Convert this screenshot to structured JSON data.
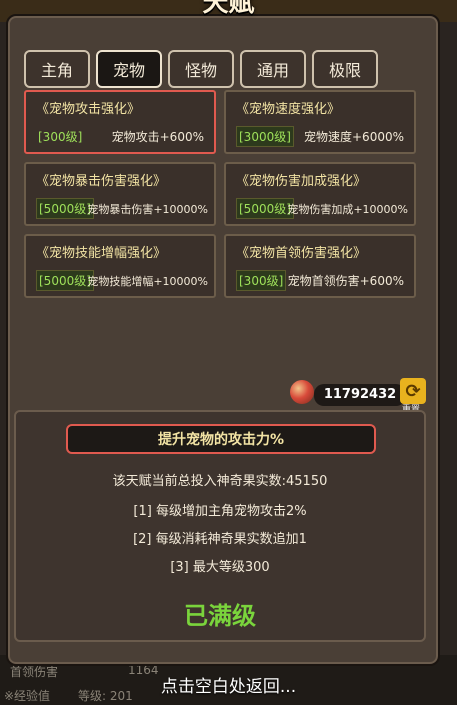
{
  "title": "天赋",
  "tabs": [
    "主角",
    "宠物",
    "怪物",
    "通用",
    "极限"
  ],
  "active_tab": "宠物",
  "cards": [
    {
      "name": "《宠物攻击强化》",
      "level": "[300级]",
      "effect": "宠物攻击+600%"
    },
    {
      "name": "《宠物速度强化》",
      "level": "[3000级]",
      "effect": "宠物速度+6000%"
    },
    {
      "name": "《宠物暴击伤害强化》",
      "level": "[5000级]",
      "effect": "宠物暴击伤害+10000%"
    },
    {
      "name": "《宠物伤害加成强化》",
      "level": "[5000级]",
      "effect": "宠物伤害加成+10000%"
    },
    {
      "name": "《宠物技能增幅强化》",
      "level": "[5000级]",
      "effect": "宠物技能增幅+10000%"
    },
    {
      "name": "《宠物首领伤害强化》",
      "level": "[300级]",
      "effect": "宠物首领伤害+600%"
    }
  ],
  "currency": {
    "amount": "11792432",
    "reset_label": "重置"
  },
  "detail": {
    "heading": "提升宠物的攻击力%",
    "invested": "该天赋当前总投入神奇果实数:45150",
    "rule1": "[1] 每级增加主角宠物攻击2%",
    "rule2": "[2] 每级消耗神奇果实数追加1",
    "rule3": "[3] 最大等级300",
    "status": "已满级"
  },
  "background": {
    "boss_dmg": "首领伤害",
    "boss_val": "1164",
    "exp": "※经验值",
    "lvl": "等级: 201"
  },
  "footer": "点击空白处返回..."
}
